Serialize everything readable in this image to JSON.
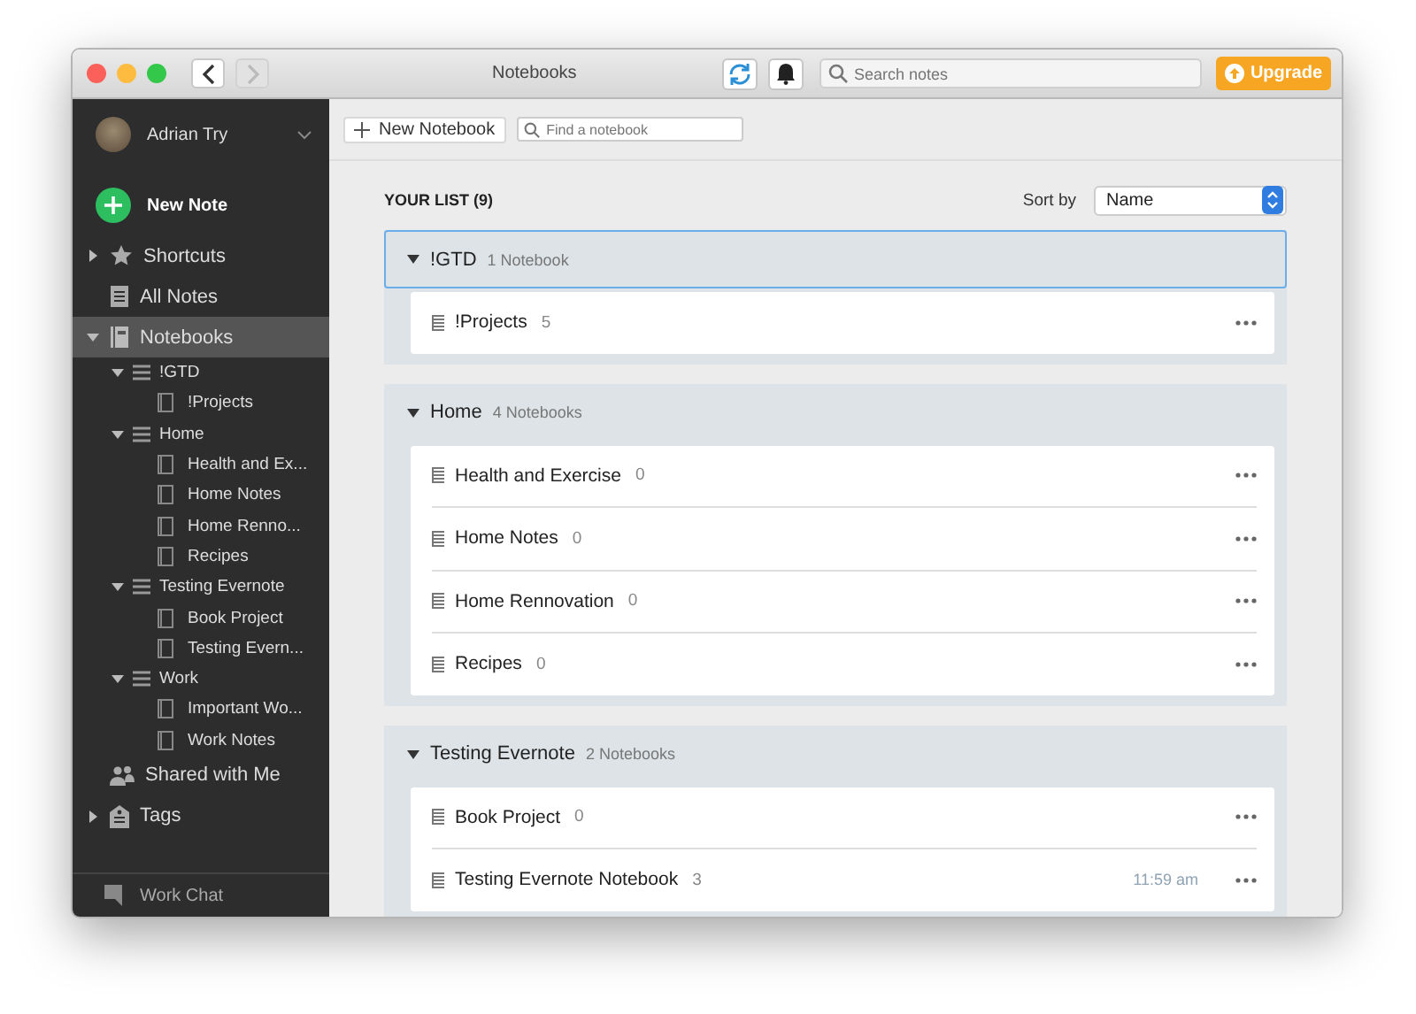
{
  "window": {
    "title": "Notebooks"
  },
  "toolbar": {
    "search": {
      "placeholder": "Search notes"
    },
    "upgrade": "Upgrade"
  },
  "sidebar": {
    "user": "Adrian Try",
    "new_note": "New Note",
    "items": [
      {
        "label": "Shortcuts",
        "expanded": false,
        "selected": false
      },
      {
        "label": "All Notes",
        "selected": false
      },
      {
        "label": "Notebooks",
        "expanded": true,
        "selected": true,
        "children": [
          {
            "label": "!GTD",
            "expanded": true,
            "children": [
              {
                "label": "!Projects"
              }
            ]
          },
          {
            "label": "Home",
            "expanded": true,
            "children": [
              {
                "label": "Health and Ex..."
              },
              {
                "label": "Home Notes"
              },
              {
                "label": "Home Renno..."
              },
              {
                "label": "Recipes"
              }
            ]
          },
          {
            "label": "Testing Evernote",
            "expanded": true,
            "children": [
              {
                "label": "Book Project"
              },
              {
                "label": "Testing Evern..."
              }
            ]
          },
          {
            "label": "Work",
            "expanded": true,
            "children": [
              {
                "label": "Important Wo..."
              },
              {
                "label": "Work Notes"
              }
            ]
          }
        ]
      },
      {
        "label": "Shared with Me",
        "selected": false
      },
      {
        "label": "Tags",
        "expanded": false,
        "selected": false
      }
    ],
    "footer": "Work Chat"
  },
  "main": {
    "new_notebook": "New Notebook",
    "find": {
      "placeholder": "Find a notebook"
    },
    "list_title": "YOUR LIST (9)",
    "sort_label": "Sort by",
    "sort_value": "Name",
    "groups": [
      {
        "name": "!GTD",
        "count": "1 Notebook",
        "selected": true,
        "expanded": true,
        "notebooks": [
          {
            "name": "!Projects",
            "count": "5"
          }
        ]
      },
      {
        "name": "Home",
        "count": "4 Notebooks",
        "selected": false,
        "expanded": true,
        "notebooks": [
          {
            "name": "Health and Exercise",
            "count": "0"
          },
          {
            "name": "Home Notes",
            "count": "0"
          },
          {
            "name": "Home Rennovation",
            "count": "0"
          },
          {
            "name": "Recipes",
            "count": "0"
          }
        ]
      },
      {
        "name": "Testing Evernote",
        "count": "2 Notebooks",
        "selected": false,
        "expanded": true,
        "notebooks": [
          {
            "name": "Book Project",
            "count": "0"
          },
          {
            "name": "Testing Evernote Notebook",
            "count": "3",
            "time": "11:59 am"
          }
        ]
      }
    ]
  }
}
